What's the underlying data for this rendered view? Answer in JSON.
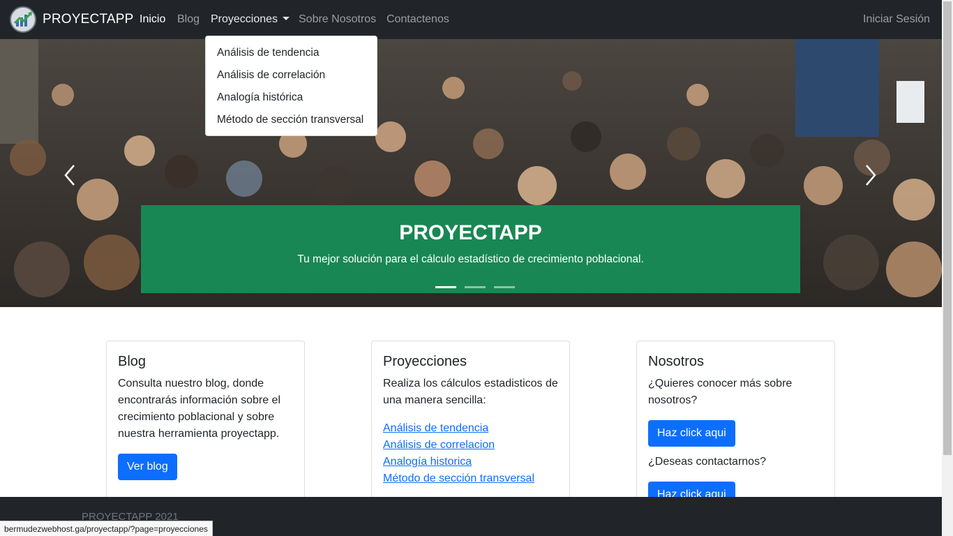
{
  "navbar": {
    "brand": "PROYECTAPP",
    "links": [
      "Inicio",
      "Blog",
      "Proyecciones",
      "Sobre Nosotros",
      "Contactenos"
    ],
    "login": "Iniciar Sesión"
  },
  "dropdown": {
    "items": [
      "Análisis de tendencia",
      "Análisis de correlación",
      "Analogía histórica",
      "Método de sección transversal"
    ]
  },
  "hero": {
    "title": "PROYECTAPP",
    "subtitle": "Tu mejor solución para el cálculo estadístico de crecimiento poblacional.",
    "active_slide": 1,
    "slides": 3
  },
  "cards": [
    {
      "title": "Blog",
      "text": "Consulta nuestro blog, donde encontrarás información sobre el crecimiento poblacional y sobre nuestra herramienta proyectapp.",
      "button": "Ver blog"
    },
    {
      "title": "Proyecciones",
      "text": "Realiza los cálculos estadisticos de una manera sencilla:",
      "links": [
        "Análisis de tendencia",
        "Análisis de correlacion",
        "Analogía historica",
        "Método de sección transversal"
      ]
    },
    {
      "title": "Nosotros",
      "question1": "¿Quieres conocer más sobre nosotros?",
      "button1": "Haz click aqui",
      "question2": "¿Deseas contactarnos?",
      "button2": "Haz click aqui"
    }
  ],
  "footer": {
    "text": "PROYECTAPP 2021"
  },
  "status_bar": {
    "url": "bermudezwebhost.ga/proyectapp/?page=proyecciones"
  },
  "colors": {
    "navbar": "#212529",
    "caption": "#198754",
    "primary": "#0d6efd"
  }
}
